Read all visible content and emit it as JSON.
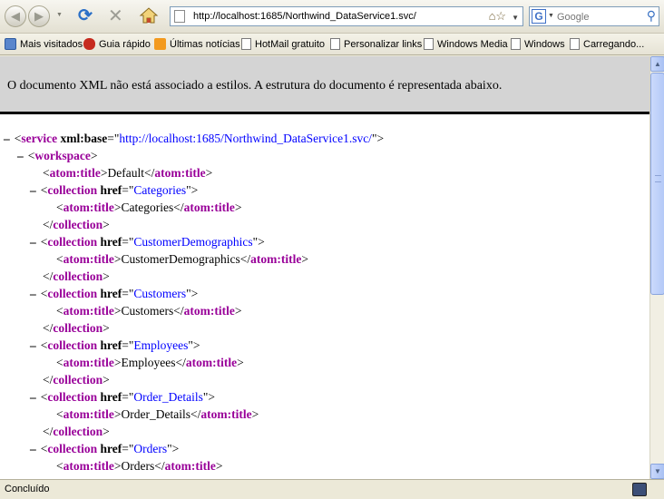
{
  "browser": {
    "url": "http://localhost:1685/Northwind_DataService1.svc/",
    "search_placeholder": "Google",
    "status": "Concluído"
  },
  "bookmarks": [
    {
      "label": "Mais visitados",
      "icon": "folder-icon"
    },
    {
      "label": "Guia rápido",
      "icon": "firefox-bug-icon"
    },
    {
      "label": "Últimas notícias",
      "icon": "rss-icon"
    },
    {
      "label": "HotMail gratuito",
      "icon": "page-icon"
    },
    {
      "label": "Personalizar links",
      "icon": "page-icon"
    },
    {
      "label": "Windows Media",
      "icon": "page-icon"
    },
    {
      "label": "Windows",
      "icon": "page-icon"
    },
    {
      "label": "Carregando...",
      "icon": "page-icon"
    }
  ],
  "infobar": {
    "message": "O documento XML não está associado a estilos. A estrutura do documento é representada abaixo."
  },
  "xml": {
    "service_tag": "service",
    "base_attr": "xml:base",
    "base_value": "http://localhost:1685/Northwind_DataService1.svc/",
    "workspace_tag": "workspace",
    "title_tag": "atom:title",
    "workspace_title": "Default",
    "collection_tag": "collection",
    "href_attr": "href",
    "collections": [
      {
        "href": "Categories",
        "title": "Categories"
      },
      {
        "href": "CustomerDemographics",
        "title": "CustomerDemographics"
      },
      {
        "href": "Customers",
        "title": "Customers"
      },
      {
        "href": "Employees",
        "title": "Employees"
      },
      {
        "href": "Order_Details",
        "title": "Order_Details"
      },
      {
        "href": "Orders",
        "title": "Orders"
      }
    ]
  },
  "colors": {
    "tag": "#990099",
    "value": "#0000ff",
    "infobar_bg": "#d4d4d4",
    "chrome_bg": "#ece9d8"
  }
}
